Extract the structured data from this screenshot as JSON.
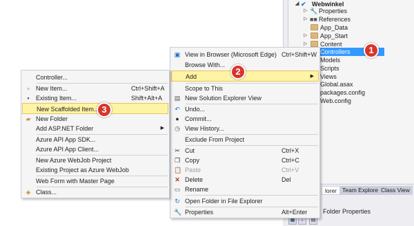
{
  "solution_explorer": {
    "project": "Webwinkel",
    "items": [
      "Properties",
      "References",
      "App_Data",
      "App_Start",
      "Content",
      "Controllers",
      "Models",
      "Scripts",
      "Views",
      "Global.asax",
      "packages.config",
      "Web.config"
    ],
    "selected": "Controllers",
    "tabs": [
      "lorer",
      "Team Explorer",
      "Class View"
    ],
    "properties_title": "Folder Properties"
  },
  "project_menu": {
    "items": [
      {
        "icon": "edge-icon",
        "label": "View in Browser (Microsoft Edge)",
        "shortcut": "Ctrl+Shift+W"
      },
      {
        "label": "Browse With..."
      },
      {
        "label": "Add",
        "submenu": true
      },
      {
        "label": "Scope to This"
      },
      {
        "icon": "explorer-view-icon",
        "label": "New Solution Explorer View"
      },
      {
        "icon": "undo-icon",
        "label": "Undo..."
      },
      {
        "icon": "commit-icon",
        "label": "Commit..."
      },
      {
        "icon": "history-icon",
        "label": "View History..."
      },
      {
        "label": "Exclude From Project"
      },
      {
        "icon": "cut-icon",
        "label": "Cut",
        "shortcut": "Ctrl+X"
      },
      {
        "icon": "copy-icon",
        "label": "Copy",
        "shortcut": "Ctrl+C"
      },
      {
        "icon": "paste-icon",
        "label": "Paste",
        "shortcut": "Ctrl+V"
      },
      {
        "icon": "delete-icon",
        "label": "Delete",
        "shortcut": "Del"
      },
      {
        "icon": "rename-icon",
        "label": "Rename"
      },
      {
        "icon": "refresh-icon",
        "label": "Open Folder in File Explorer"
      },
      {
        "icon": "wrench-icon",
        "label": "Properties",
        "shortcut": "Alt+Enter"
      }
    ]
  },
  "add_menu": {
    "items": [
      {
        "label": "Controller..."
      },
      {
        "icon": "new-item-icon",
        "label": "New Item...",
        "shortcut": "Ctrl+Shift+A"
      },
      {
        "icon": "existing-item-icon",
        "label": "Existing Item...",
        "shortcut": "Shift+Alt+A"
      },
      {
        "label": "New Scaffolded Item..."
      },
      {
        "icon": "new-folder-icon",
        "label": "New Folder"
      },
      {
        "label": "Add ASP.NET Folder",
        "submenu": true
      },
      {
        "label": "Azure API App SDK..."
      },
      {
        "label": "Azure API App Client..."
      },
      {
        "label": "New Azure WebJob Project"
      },
      {
        "label": "Existing Project as Azure WebJob"
      },
      {
        "label": "Web Form with Master Page"
      },
      {
        "icon": "class-icon",
        "label": "Class..."
      }
    ]
  },
  "callouts": [
    "1",
    "2",
    "3"
  ],
  "colors": {
    "highlight": "#fff3a4",
    "selection": "#3399ff",
    "badge": "#d9352a"
  }
}
